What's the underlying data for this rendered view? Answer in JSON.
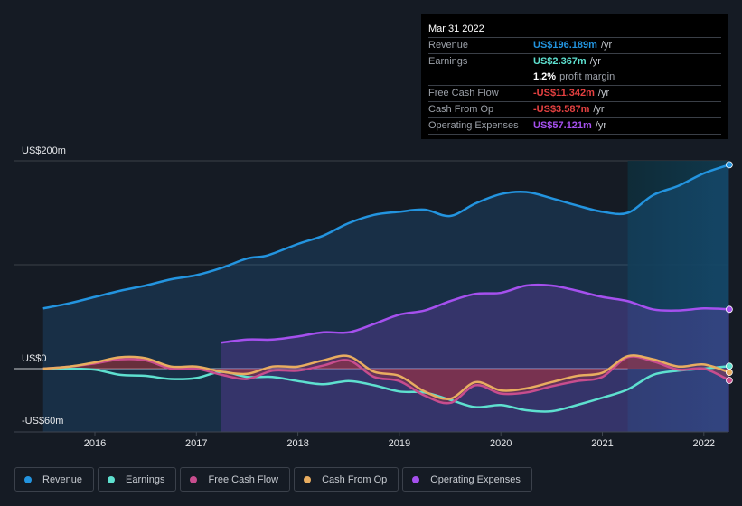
{
  "tooltip": {
    "date": "Mar 31 2022",
    "rows": [
      {
        "label": "Revenue",
        "value": "US$196.189m",
        "unit": "/yr",
        "color": "#2394df"
      },
      {
        "label": "Earnings",
        "value": "US$2.367m",
        "unit": "/yr",
        "color": "#5ee0cf"
      },
      {
        "label": "",
        "value": "1.2%",
        "unit": "profit margin",
        "color": "#ffffff"
      },
      {
        "label": "Free Cash Flow",
        "value": "-US$11.342m",
        "unit": "/yr",
        "color": "#e64141"
      },
      {
        "label": "Cash From Op",
        "value": "-US$3.587m",
        "unit": "/yr",
        "color": "#e64141"
      },
      {
        "label": "Operating Expenses",
        "value": "US$57.121m",
        "unit": "/yr",
        "color": "#a550ee"
      }
    ]
  },
  "legend": [
    {
      "label": "Revenue",
      "color": "#2394df"
    },
    {
      "label": "Earnings",
      "color": "#5ee0cf"
    },
    {
      "label": "Free Cash Flow",
      "color": "#c84d8e"
    },
    {
      "label": "Cash From Op",
      "color": "#e8ad60"
    },
    {
      "label": "Operating Expenses",
      "color": "#a550ee"
    }
  ],
  "chart_data": {
    "type": "area",
    "title": "",
    "xlabel": "",
    "ylabel": "",
    "xlim": [
      2015.1,
      2022.25
    ],
    "ylim": [
      -60,
      200
    ],
    "y_ticks": [
      {
        "value": 200,
        "label": "US$200m"
      },
      {
        "value": 0,
        "label": "US$0"
      },
      {
        "value": -60,
        "label": "-US$60m"
      }
    ],
    "x_ticks": [
      {
        "value": 2016,
        "label": "2016"
      },
      {
        "value": 2017,
        "label": "2017"
      },
      {
        "value": 2018,
        "label": "2018"
      },
      {
        "value": 2019,
        "label": "2019"
      },
      {
        "value": 2020,
        "label": "2020"
      },
      {
        "value": 2021,
        "label": "2021"
      },
      {
        "value": 2022,
        "label": "2022"
      }
    ],
    "gridlines": [
      200,
      100,
      0
    ],
    "highlight_from": 2021.25,
    "series": [
      {
        "name": "Revenue",
        "color": "#2394df",
        "x": [
          2015.49,
          2015.75,
          2016.0,
          2016.25,
          2016.5,
          2016.75,
          2017.0,
          2017.25,
          2017.5,
          2017.7,
          2018.0,
          2018.25,
          2018.5,
          2018.75,
          2019.0,
          2019.25,
          2019.5,
          2019.75,
          2020.0,
          2020.25,
          2020.5,
          2020.75,
          2021.0,
          2021.25,
          2021.5,
          2021.75,
          2022.0,
          2022.25
        ],
        "y": [
          58,
          63,
          69,
          75,
          80,
          86,
          90,
          97,
          106,
          109,
          120,
          128,
          140,
          148,
          151,
          153,
          147,
          159,
          168,
          170,
          164,
          157,
          151,
          150,
          167,
          176,
          188,
          196.2
        ]
      },
      {
        "name": "Operating Expenses",
        "color": "#a550ee",
        "x": [
          2017.24,
          2017.5,
          2017.75,
          2018.0,
          2018.25,
          2018.5,
          2018.75,
          2019.0,
          2019.25,
          2019.5,
          2019.75,
          2020.0,
          2020.25,
          2020.5,
          2020.75,
          2021.0,
          2021.25,
          2021.5,
          2021.75,
          2022.0,
          2022.25
        ],
        "y": [
          25,
          28,
          28,
          31,
          35,
          35,
          43,
          52,
          56,
          65,
          72,
          73,
          80,
          80,
          75,
          69,
          65,
          57,
          56,
          58,
          57.1
        ]
      },
      {
        "name": "Earnings",
        "color": "#5ee0cf",
        "x": [
          2015.49,
          2015.75,
          2016.0,
          2016.25,
          2016.5,
          2016.75,
          2017.0,
          2017.25,
          2017.5,
          2017.75,
          2018.0,
          2018.25,
          2018.5,
          2018.75,
          2019.0,
          2019.25,
          2019.5,
          2019.75,
          2020.0,
          2020.25,
          2020.5,
          2020.75,
          2021.0,
          2021.25,
          2021.5,
          2021.75,
          2022.0,
          2022.25
        ],
        "y": [
          0,
          0,
          -1,
          -6,
          -7,
          -10,
          -9,
          -3,
          -8,
          -8,
          -12,
          -15,
          -12,
          -16,
          -22,
          -23,
          -30,
          -37,
          -35,
          -40,
          -41,
          -35,
          -28,
          -20,
          -6,
          -2,
          0,
          2.4
        ]
      },
      {
        "name": "Free Cash Flow",
        "color": "#c84d8e",
        "x": [
          2015.49,
          2015.75,
          2016.0,
          2016.25,
          2016.5,
          2016.75,
          2017.0,
          2017.25,
          2017.5,
          2017.75,
          2018.0,
          2018.25,
          2018.5,
          2018.75,
          2019.0,
          2019.25,
          2019.5,
          2019.75,
          2020.0,
          2020.25,
          2020.5,
          2020.75,
          2021.0,
          2021.25,
          2021.5,
          2021.75,
          2022.0,
          2022.25
        ],
        "y": [
          0,
          2,
          5,
          9,
          8,
          0,
          0,
          -6,
          -10,
          -2,
          -2,
          3,
          8,
          -8,
          -12,
          -26,
          -33,
          -16,
          -24,
          -23,
          -17,
          -12,
          -8,
          11,
          7,
          -1,
          0,
          -11.3
        ]
      },
      {
        "name": "Cash From Op",
        "color": "#e8ad60",
        "x": [
          2015.49,
          2015.75,
          2016.0,
          2016.25,
          2016.5,
          2016.75,
          2017.0,
          2017.25,
          2017.5,
          2017.75,
          2018.0,
          2018.25,
          2018.5,
          2018.75,
          2019.0,
          2019.25,
          2019.5,
          2019.75,
          2020.0,
          2020.25,
          2020.5,
          2020.75,
          2021.0,
          2021.25,
          2021.5,
          2021.75,
          2022.0,
          2022.25
        ],
        "y": [
          0,
          2,
          6,
          11,
          10,
          2,
          2,
          -3,
          -5,
          2,
          2,
          8,
          12,
          -3,
          -7,
          -22,
          -29,
          -13,
          -21,
          -19,
          -13,
          -7,
          -4,
          12,
          9,
          2,
          4,
          -3.6
        ]
      }
    ]
  }
}
